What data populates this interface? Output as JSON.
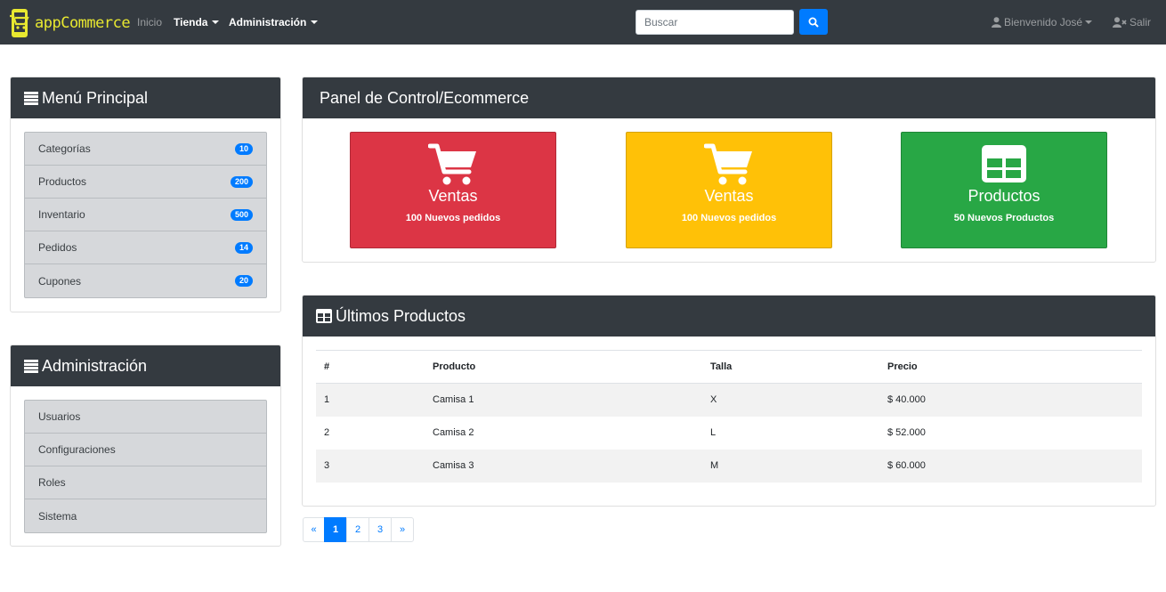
{
  "navbar": {
    "brand": "appCommerce",
    "inicio": "Inicio",
    "tienda": "Tienda",
    "administracion": "Administración",
    "search_placeholder": "Buscar",
    "user": "Bienvenido José",
    "salir": "Salir"
  },
  "menu_principal": {
    "title": "Menú Principal",
    "items": [
      {
        "label": "Categorías",
        "badge": "10"
      },
      {
        "label": "Productos",
        "badge": "200"
      },
      {
        "label": "Inventario",
        "badge": "500"
      },
      {
        "label": "Pedidos",
        "badge": "14"
      },
      {
        "label": "Cupones",
        "badge": "20"
      }
    ]
  },
  "administracion": {
    "title": "Administración",
    "items": [
      {
        "label": "Usuarios"
      },
      {
        "label": "Configuraciones"
      },
      {
        "label": "Roles"
      },
      {
        "label": "Sistema"
      }
    ]
  },
  "panel": {
    "title": "Panel de Control/Ecommerce",
    "tiles": [
      {
        "title": "Ventas",
        "subtitle": "100 Nuevos pedidos",
        "icon": "shopping-cart-icon",
        "color": "#dc3545"
      },
      {
        "title": "Ventas",
        "subtitle": "100 Nuevos pedidos",
        "icon": "shopping-cart-icon",
        "color": "#ffc107"
      },
      {
        "title": "Productos",
        "subtitle": "50 Nuevos Productos",
        "icon": "table-icon",
        "color": "#28a745"
      }
    ]
  },
  "ultimos": {
    "title": "Últimos Productos",
    "columns": [
      "#",
      "Producto",
      "Talla",
      "Precio"
    ],
    "rows": [
      [
        "1",
        "Camisa 1",
        "X",
        "$ 40.000"
      ],
      [
        "2",
        "Camisa 2",
        "L",
        "$ 52.000"
      ],
      [
        "3",
        "Camisa 3",
        "M",
        "$ 60.000"
      ]
    ]
  },
  "pagination": {
    "prev": "«",
    "pages": [
      "1",
      "2",
      "3"
    ],
    "next": "»",
    "active": "1"
  },
  "colors": {
    "navbar": "#343a40",
    "primary": "#007bff",
    "brand": "#e8e830"
  }
}
